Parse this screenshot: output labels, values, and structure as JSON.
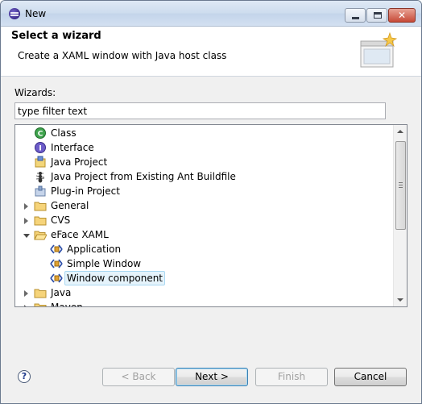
{
  "window": {
    "title": "New",
    "minimize_icon": "minimize-icon",
    "maximize_icon": "maximize-icon",
    "close_icon": "close-icon"
  },
  "banner": {
    "title": "Select a wizard",
    "description": "Create a XAML window with Java host class",
    "graphic_icon": "wizard-window-icon"
  },
  "wizards": {
    "label": "Wizards:",
    "filter_value": "type filter text"
  },
  "tree": {
    "items": [
      {
        "label": "Class",
        "icon": "java-class-icon",
        "level": 1,
        "expander": "none"
      },
      {
        "label": "Interface",
        "icon": "java-interface-icon",
        "level": 1,
        "expander": "none"
      },
      {
        "label": "Java Project",
        "icon": "java-project-icon",
        "level": 1,
        "expander": "none"
      },
      {
        "label": "Java Project from Existing Ant Buildfile",
        "icon": "ant-icon",
        "level": 1,
        "expander": "none"
      },
      {
        "label": "Plug-in Project",
        "icon": "plugin-project-icon",
        "level": 1,
        "expander": "none"
      },
      {
        "label": "General",
        "icon": "folder-icon",
        "level": 1,
        "expander": "collapsed"
      },
      {
        "label": "CVS",
        "icon": "folder-icon",
        "level": 1,
        "expander": "collapsed"
      },
      {
        "label": "eFace XAML",
        "icon": "folder-open-icon",
        "level": 1,
        "expander": "expanded"
      },
      {
        "label": "Application",
        "icon": "xaml-icon",
        "level": 2,
        "expander": "none"
      },
      {
        "label": "Simple Window",
        "icon": "xaml-icon",
        "level": 2,
        "expander": "none"
      },
      {
        "label": "Window component",
        "icon": "xaml-icon",
        "level": 2,
        "expander": "none",
        "selected": true
      },
      {
        "label": "Java",
        "icon": "folder-icon",
        "level": 1,
        "expander": "collapsed"
      },
      {
        "label": "Maven",
        "icon": "folder-icon",
        "level": 1,
        "expander": "collapsed"
      }
    ]
  },
  "buttons": {
    "help_icon": "help-icon",
    "help": "?",
    "back": "< Back",
    "next": "Next >",
    "finish": "Finish",
    "cancel": "Cancel"
  },
  "colors": {
    "selection_bg": "#e5f3fb",
    "selection_border": "#a9d8f2",
    "default_button_border": "#3c7fb1"
  }
}
